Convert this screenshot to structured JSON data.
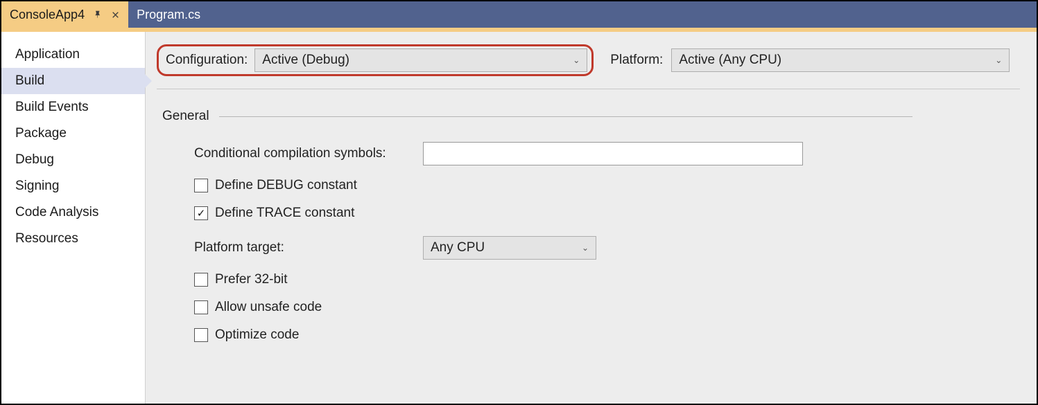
{
  "tabs": {
    "active": {
      "label": "ConsoleApp4"
    },
    "other": {
      "label": "Program.cs"
    }
  },
  "sidebar": {
    "items": [
      {
        "label": "Application"
      },
      {
        "label": "Build"
      },
      {
        "label": "Build Events"
      },
      {
        "label": "Package"
      },
      {
        "label": "Debug"
      },
      {
        "label": "Signing"
      },
      {
        "label": "Code Analysis"
      },
      {
        "label": "Resources"
      }
    ]
  },
  "toprow": {
    "configuration_label": "Configuration:",
    "configuration_value": "Active (Debug)",
    "platform_label": "Platform:",
    "platform_value": "Active (Any CPU)"
  },
  "section": {
    "title": "General",
    "conditional_symbols_label": "Conditional compilation symbols:",
    "conditional_symbols_value": "",
    "define_debug_label": "Define DEBUG constant",
    "define_debug_checked": false,
    "define_trace_label": "Define TRACE constant",
    "define_trace_checked": true,
    "platform_target_label": "Platform target:",
    "platform_target_value": "Any CPU",
    "prefer_32bit_label": "Prefer 32-bit",
    "prefer_32bit_checked": false,
    "allow_unsafe_label": "Allow unsafe code",
    "allow_unsafe_checked": false,
    "optimize_code_label": "Optimize code",
    "optimize_code_checked": false
  }
}
